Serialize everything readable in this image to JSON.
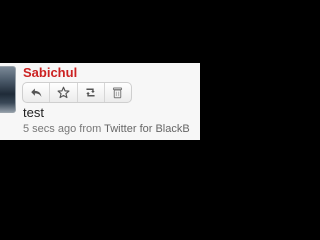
{
  "tweet": {
    "username": "Sabichul",
    "text": "test",
    "timestamp": "5 secs ago",
    "source_prefix": "from",
    "source": "Twitter for BlackB"
  },
  "actions": [
    {
      "icon": "reply-icon"
    },
    {
      "icon": "favorite-star-icon"
    },
    {
      "icon": "retweet-icon"
    },
    {
      "icon": "delete-trash-icon"
    }
  ],
  "colors": {
    "username": "#cc2222",
    "background": "#000000",
    "card": "#f7f7f7"
  }
}
